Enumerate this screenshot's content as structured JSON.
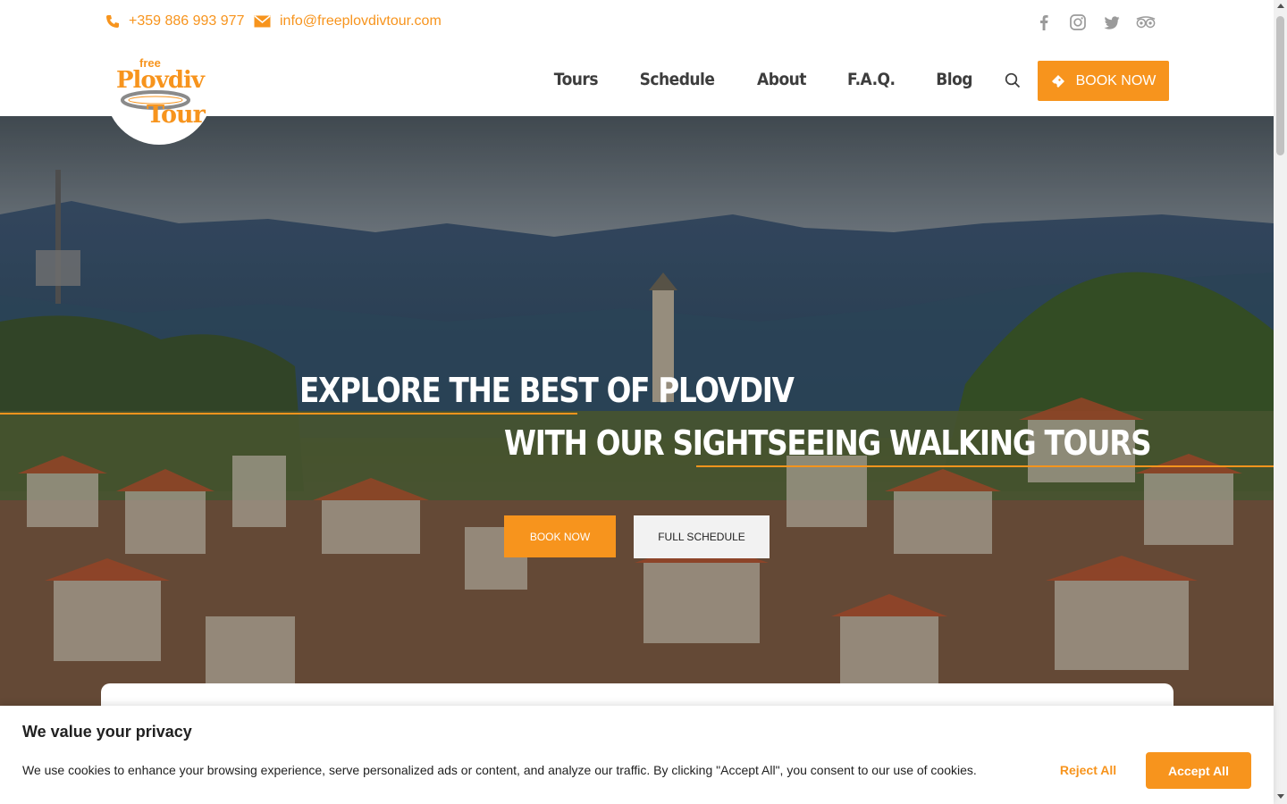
{
  "topbar": {
    "phone": "+359 886 993 977",
    "email": "info@freeplovdivtour.com",
    "social": [
      "facebook-icon",
      "instagram-icon",
      "twitter-icon",
      "tripadvisor-icon"
    ]
  },
  "logo": {
    "free": "free",
    "plovdiv": "Plovdiv",
    "tour": "Tour"
  },
  "nav": {
    "items": [
      "Tours",
      "Schedule",
      "About",
      "F.A.Q.",
      "Blog"
    ],
    "book_label": "BOOK NOW"
  },
  "hero": {
    "title_line1": "EXPLORE THE BEST OF PLOVDIV",
    "title_line2": "WITH OUR SIGHTSEEING WALKING TOURS",
    "book_label": "BOOK NOW",
    "schedule_label": "FULL SCHEDULE"
  },
  "cookie": {
    "title": "We value your privacy",
    "text": "We use cookies to enhance your browsing experience, serve personalized ads or content, and analyze our traffic. By clicking \"Accept All\", you consent to our use of cookies.",
    "reject_label": "Reject All",
    "accept_label": "Accept All"
  },
  "colors": {
    "accent": "#f7941d",
    "nav_text": "#3d3d3d",
    "social_icon": "#9a9a9a"
  }
}
